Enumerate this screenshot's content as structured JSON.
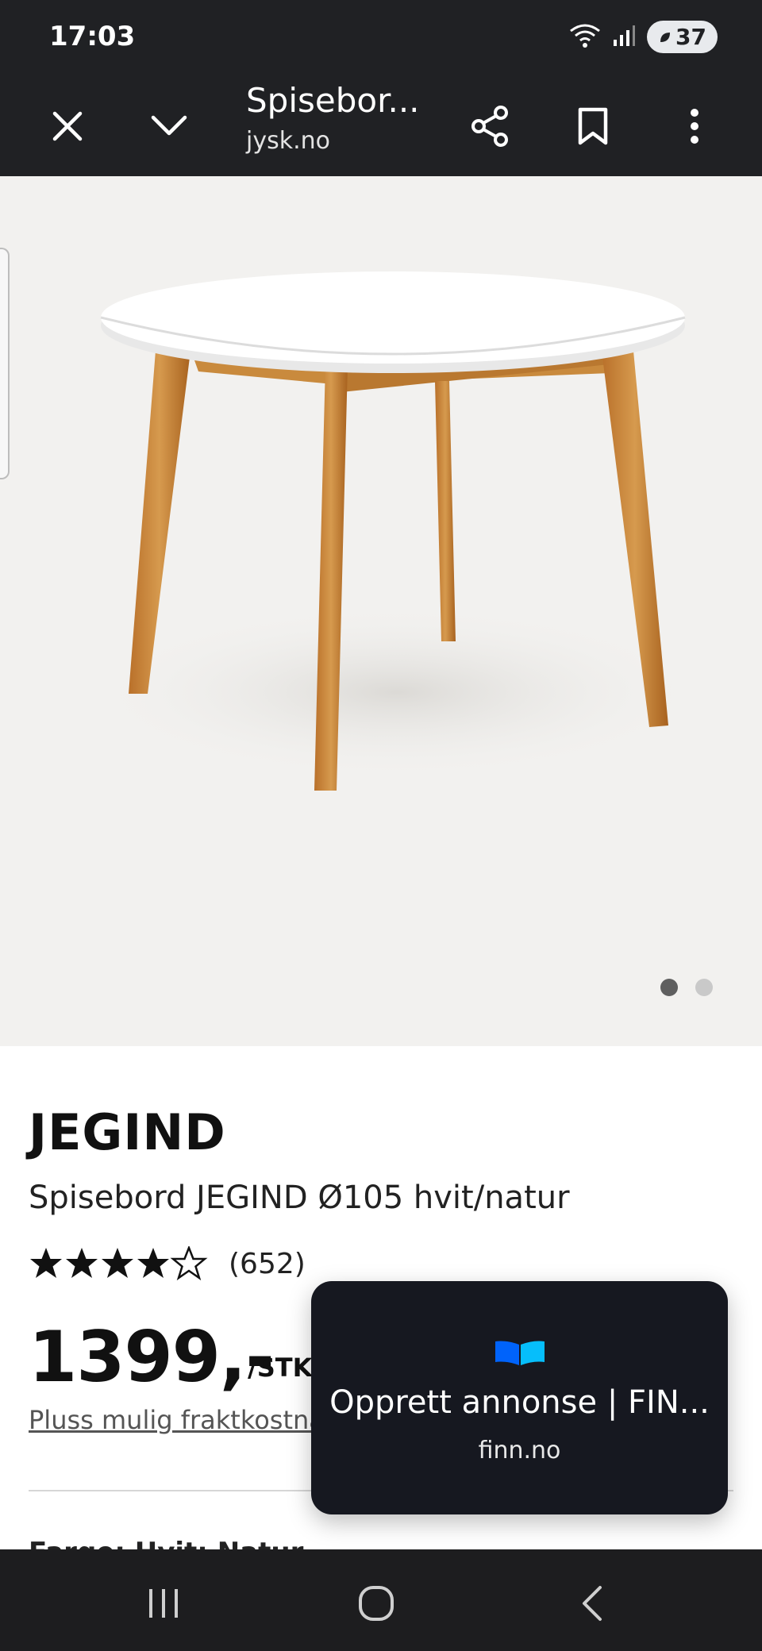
{
  "status_bar": {
    "time": "17:03",
    "battery_level": "37",
    "icons": [
      "wifi-icon",
      "signal-icon",
      "battery-icon"
    ]
  },
  "browser": {
    "page_title": "Spisebor...",
    "url": "jysk.no",
    "icons": [
      "close-icon",
      "chevron-down-icon",
      "share-icon",
      "bookmark-icon",
      "more-vert-icon"
    ]
  },
  "gallery": {
    "image": "round-dining-table-image",
    "slide_count": 2,
    "active_slide": 1
  },
  "product": {
    "brand": "JEGIND",
    "name": "Spisebord JEGIND Ø105 hvit/natur",
    "rating": 4.5,
    "rating_count": "(652)",
    "price": "1399,-",
    "unit": "/STK.",
    "shipping_note": "Pluss mulig fraktkostnad",
    "next_section_partial": "Farge: Hvit; Natur"
  },
  "popup": {
    "title": "Opprett annonse | FIN...",
    "subtitle": "finn.no"
  },
  "nav_bar": {
    "icons": [
      "recent-apps-icon",
      "home-icon",
      "back-icon"
    ]
  },
  "colors": {
    "chrome_bg": "#202124",
    "gallery_bg": "#f2f1ef",
    "popup_bg": "#161820",
    "finn_blue_dark": "#0063fb",
    "finn_blue_light": "#06befb"
  }
}
